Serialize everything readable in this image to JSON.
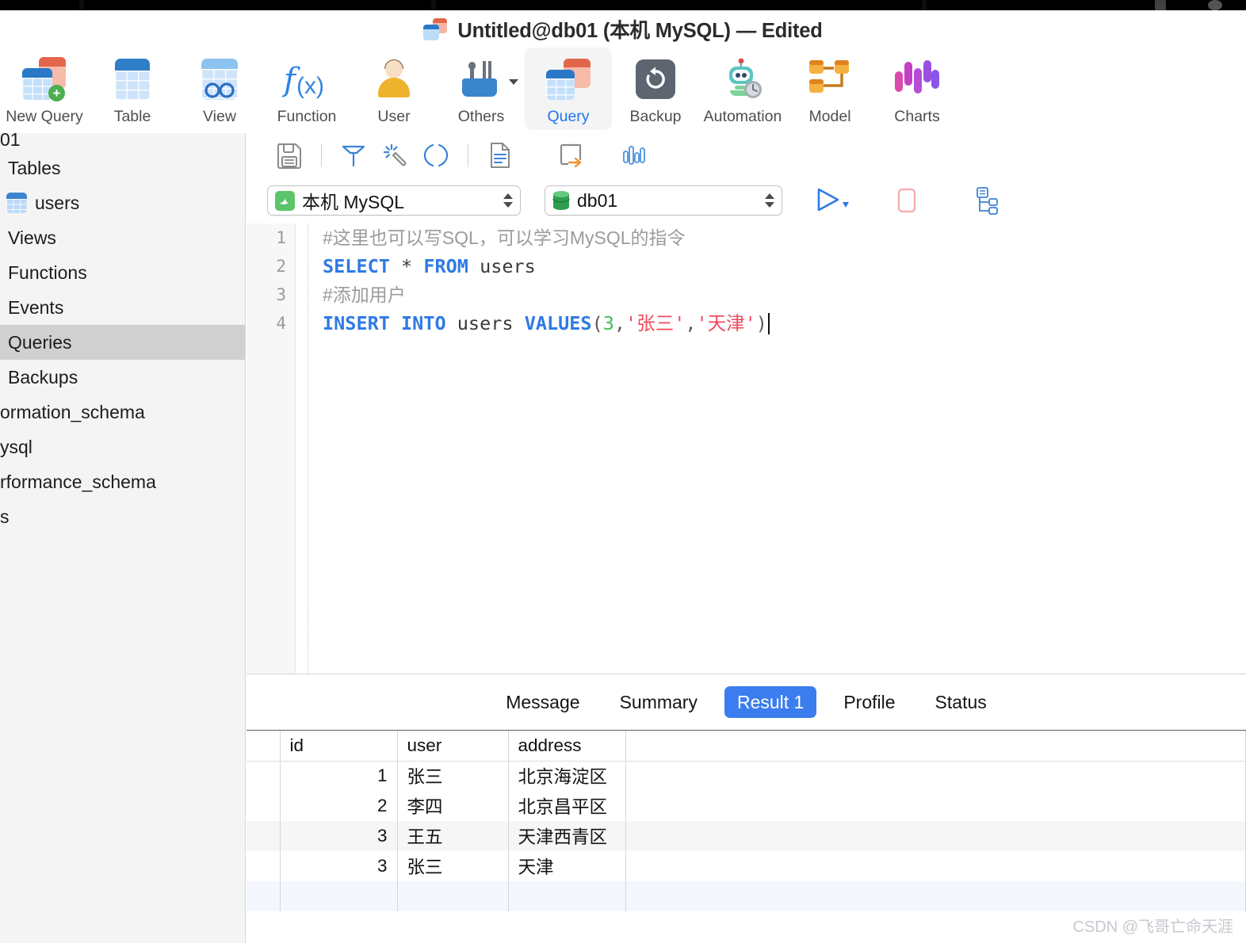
{
  "window": {
    "title": "Untitled@db01 (本机 MySQL) — Edited",
    "title_icon": "query-document-icon"
  },
  "toolbar": {
    "items": [
      {
        "label": "New Query",
        "icon": "new-query-icon",
        "active": false
      },
      {
        "label": "Table",
        "icon": "table-icon",
        "active": false
      },
      {
        "label": "View",
        "icon": "view-icon",
        "active": false
      },
      {
        "label": "Function",
        "icon": "function-fx-icon",
        "active": false
      },
      {
        "label": "User",
        "icon": "user-icon",
        "active": false
      },
      {
        "label": "Others",
        "icon": "others-tools-icon",
        "active": false
      },
      {
        "label": "Query",
        "icon": "query-icon",
        "active": true
      },
      {
        "label": "Backup",
        "icon": "backup-restore-icon",
        "active": false
      },
      {
        "label": "Automation",
        "icon": "automation-robot-icon",
        "active": false
      },
      {
        "label": "Model",
        "icon": "model-diagram-icon",
        "active": false
      },
      {
        "label": "Charts",
        "icon": "charts-icon",
        "active": false
      }
    ]
  },
  "sidebar": {
    "items": [
      {
        "label": "01",
        "icon": null,
        "selected": false,
        "clipped": true
      },
      {
        "label": "Tables",
        "icon": null,
        "selected": false
      },
      {
        "label": "users",
        "icon": "table-icon",
        "selected": false
      },
      {
        "label": "Views",
        "icon": null,
        "selected": false
      },
      {
        "label": "Functions",
        "icon": null,
        "selected": false
      },
      {
        "label": "Events",
        "icon": null,
        "selected": false
      },
      {
        "label": "Queries",
        "icon": null,
        "selected": true
      },
      {
        "label": "Backups",
        "icon": null,
        "selected": false
      },
      {
        "label": "ormation_schema",
        "icon": null,
        "selected": false
      },
      {
        "label": "ysql",
        "icon": null,
        "selected": false
      },
      {
        "label": "rformance_schema",
        "icon": null,
        "selected": false
      },
      {
        "label": "s",
        "icon": null,
        "selected": false
      }
    ]
  },
  "sub_toolbar": {
    "buttons": [
      {
        "name": "save-icon"
      },
      {
        "name": "query-builder-icon"
      },
      {
        "name": "beautify-magic-wand-icon"
      },
      {
        "name": "parentheses-icon"
      },
      {
        "name": "text-document-icon"
      },
      {
        "name": "export-result-icon"
      },
      {
        "name": "chart-bars-icon"
      }
    ]
  },
  "connection_bar": {
    "connection": {
      "value": "本机 MySQL",
      "icon": "mysql-dolphin-icon"
    },
    "database": {
      "value": "db01",
      "icon": "database-cylinder-icon"
    },
    "run": {
      "name": "run-icon"
    },
    "stop": {
      "name": "stop-icon"
    },
    "explain": {
      "name": "explain-plan-icon"
    }
  },
  "editor": {
    "lines": [
      {
        "number": "1",
        "tokens": [
          {
            "t": "comment",
            "v": "#这里也可以写SQL，可以学习MySQL的指令"
          }
        ]
      },
      {
        "number": "2",
        "tokens": [
          {
            "t": "kw",
            "v": "SELECT"
          },
          {
            "t": "op",
            "v": " * "
          },
          {
            "t": "kw",
            "v": "FROM"
          },
          {
            "t": "id",
            "v": " users"
          }
        ]
      },
      {
        "number": "3",
        "tokens": [
          {
            "t": "comment",
            "v": "#添加用户"
          }
        ]
      },
      {
        "number": "4",
        "tokens": [
          {
            "t": "kw",
            "v": "INSERT INTO"
          },
          {
            "t": "id",
            "v": " users "
          },
          {
            "t": "kw",
            "v": "VALUES"
          },
          {
            "t": "punc",
            "v": "("
          },
          {
            "t": "num",
            "v": "3"
          },
          {
            "t": "punc",
            "v": ","
          },
          {
            "t": "str",
            "v": "'张三'"
          },
          {
            "t": "punc",
            "v": ","
          },
          {
            "t": "str",
            "v": "'天津'"
          },
          {
            "t": "punc",
            "v": ")"
          },
          {
            "t": "caret",
            "v": ""
          }
        ]
      }
    ]
  },
  "results": {
    "tabs": [
      {
        "label": "Message",
        "active": false
      },
      {
        "label": "Summary",
        "active": false
      },
      {
        "label": "Result 1",
        "active": true
      },
      {
        "label": "Profile",
        "active": false
      },
      {
        "label": "Status",
        "active": false
      }
    ],
    "columns": [
      "id",
      "user",
      "address"
    ],
    "rows": [
      {
        "id": "1",
        "user": "张三",
        "address": "北京海淀区"
      },
      {
        "id": "2",
        "user": "李四",
        "address": "北京昌平区"
      },
      {
        "id": "3",
        "user": "王五",
        "address": "天津西青区"
      },
      {
        "id": "3",
        "user": "张三",
        "address": "天津"
      }
    ]
  },
  "watermark": {
    "text": "CSDN @飞哥亡命天涯"
  },
  "colors": {
    "accent_blue": "#3b7def",
    "keyword_blue": "#2f7ae5",
    "string_red": "#ef4a5c",
    "number_green": "#3fbf54",
    "comment_gray": "#9b9b9b",
    "sidebar_bg": "#f4f4f4",
    "selection_gray": "#d0d0d0"
  }
}
